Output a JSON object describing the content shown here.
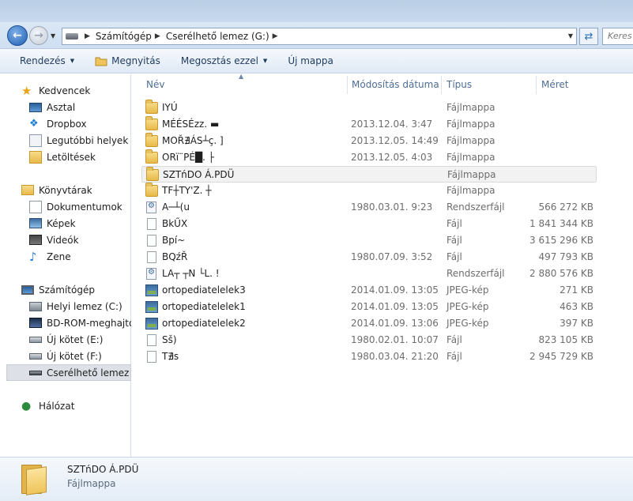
{
  "address": {
    "segments": [
      "Számítógép",
      "Cserélhető lemez (G:)"
    ],
    "search_placeholder": "Keres"
  },
  "toolbar": {
    "organize": "Rendezés",
    "open": "Megnyitás",
    "share": "Megosztás ezzel",
    "new_folder": "Új mappa"
  },
  "nav": {
    "favorites": "Kedvencek",
    "desktop": "Asztal",
    "dropbox": "Dropbox",
    "recent": "Legutóbbi helyek",
    "downloads": "Letöltések",
    "libraries": "Könyvtárak",
    "documents": "Dokumentumok",
    "pictures": "Képek",
    "videos": "Videók",
    "music": "Zene",
    "computer": "Számítógép",
    "local_c": "Helyi lemez (C:)",
    "bd_rom": "BD-ROM-meghajtó",
    "vol_e": "Új kötet (E:)",
    "vol_f": "Új kötet (F:)",
    "removable": "Cserélhető lemez (G:)",
    "network": "Hálózat"
  },
  "columns": {
    "name": "Név",
    "modified": "Módosítás dátuma",
    "type": "Típus",
    "size": "Méret"
  },
  "files": [
    {
      "name": "IYÚ",
      "date": "",
      "type": "Fájlmappa",
      "size": "",
      "icon": "folder"
    },
    {
      "name": "MÉÉSÉzz. ▬",
      "date": "2013.12.04. 3:47",
      "type": "Fájlmappa",
      "size": "",
      "icon": "folder"
    },
    {
      "name": "MOŘ∄ÁS┴ç. ]",
      "date": "2013.12.05. 14:49",
      "type": "Fájlmappa",
      "size": "",
      "icon": "folder"
    },
    {
      "name": "ORï¨PÉ█. ├",
      "date": "2013.12.05. 4:03",
      "type": "Fájlmappa",
      "size": "",
      "icon": "folder"
    },
    {
      "name": "SZTńDO Á.PDÜ",
      "date": "",
      "type": "Fájlmappa",
      "size": "",
      "icon": "folder"
    },
    {
      "name": "TF┼TY'Z. ┼",
      "date": "",
      "type": "Fájlmappa",
      "size": "",
      "icon": "folder"
    },
    {
      "name": "A─┴(u",
      "date": "1980.03.01. 9:23",
      "type": "Rendszerfájl",
      "size": "566 272 KB",
      "icon": "sys"
    },
    {
      "name": "BkŰX",
      "date": "",
      "type": "Fájl",
      "size": "1 841 344 KB",
      "icon": "file"
    },
    {
      "name": "Bpí~",
      "date": "",
      "type": "Fájl",
      "size": "3 615 296 KB",
      "icon": "file"
    },
    {
      "name": "BQźŘ",
      "date": "1980.07.09. 3:52",
      "type": "Fájl",
      "size": "497 793 KB",
      "icon": "file"
    },
    {
      "name": "LA┬ ┬N └L. !",
      "date": "",
      "type": "Rendszerfájl",
      "size": "2 880 576 KB",
      "icon": "sys"
    },
    {
      "name": "ortopediatelelek3",
      "date": "2014.01.09. 13:05",
      "type": "JPEG-kép",
      "size": "271 KB",
      "icon": "jpg"
    },
    {
      "name": "ortopediatelelek1",
      "date": "2014.01.09. 13:05",
      "type": "JPEG-kép",
      "size": "463 KB",
      "icon": "jpg"
    },
    {
      "name": "ortopediatelelek2",
      "date": "2014.01.09. 13:06",
      "type": "JPEG-kép",
      "size": "397 KB",
      "icon": "jpg"
    },
    {
      "name": "Sš)",
      "date": "1980.02.01. 10:07",
      "type": "Fájl",
      "size": "823 105 KB",
      "icon": "file"
    },
    {
      "name": "T∄s",
      "date": "1980.03.04. 21:20",
      "type": "Fájl",
      "size": "2 945 729 KB",
      "icon": "file"
    }
  ],
  "details": {
    "name": "SZTńDO Á.PDÜ",
    "type": "Fájlmappa"
  }
}
